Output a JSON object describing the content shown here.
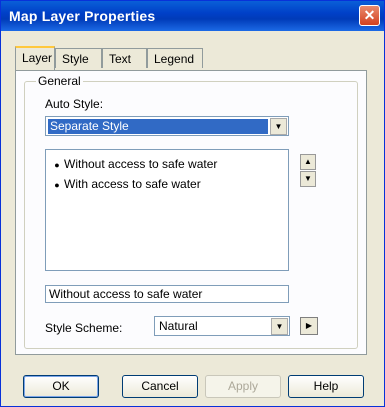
{
  "window": {
    "title": "Map Layer Properties",
    "close_glyph": "✕"
  },
  "tabs": [
    {
      "label": "Layer",
      "active": true
    },
    {
      "label": "Style",
      "active": false
    },
    {
      "label": "Text",
      "active": false
    },
    {
      "label": "Legend",
      "active": false
    }
  ],
  "general": {
    "legend": "General",
    "auto_style_label": "Auto Style:",
    "auto_style_value": "Separate Style",
    "items": [
      "Without access to safe water",
      "With access to safe water"
    ],
    "item_name_value": "Without access to safe water",
    "style_scheme_label": "Style Scheme:",
    "style_scheme_value": "Natural"
  },
  "buttons": {
    "ok": "OK",
    "cancel": "Cancel",
    "apply": "Apply",
    "help": "Help"
  },
  "icons": {
    "close": "close-icon",
    "dropdown": "chevron-down-icon",
    "up": "arrow-up-icon",
    "down": "arrow-down-icon",
    "play": "play-icon"
  },
  "colors": {
    "titlebar": "#0040c8",
    "selection": "#316ac5",
    "tab_highlight": "#ffc83c"
  }
}
